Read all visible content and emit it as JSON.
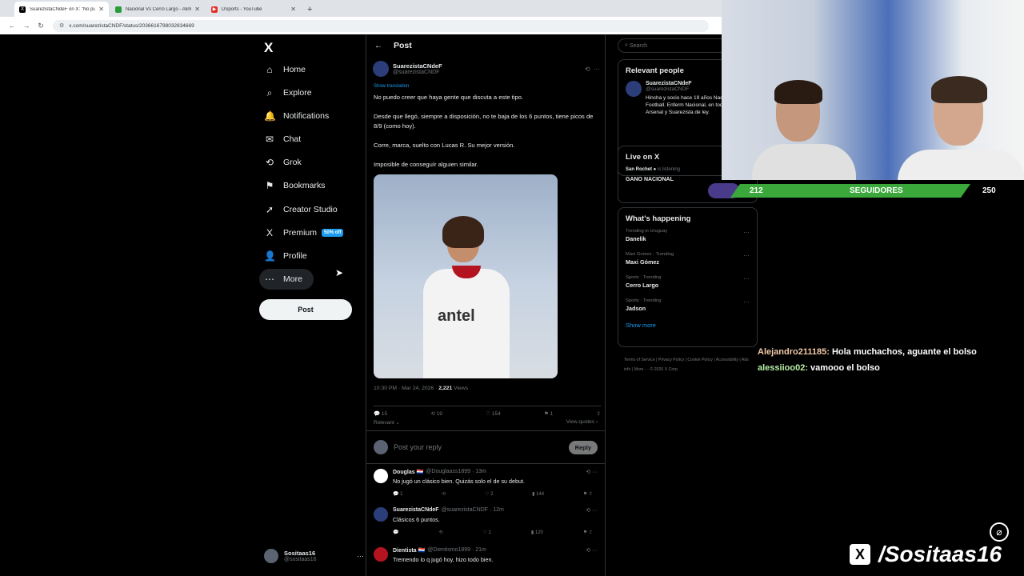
{
  "browser": {
    "tabs": [
      {
        "title": "SuarezistaCNdeF on X: \"No pue",
        "active": true,
        "favicon": "X"
      },
      {
        "title": "Nacional Vs Cerro Largo - Alim",
        "active": false,
        "favicon": "●"
      },
      {
        "title": "DSports - YouTube",
        "active": false,
        "favicon": "▶"
      }
    ],
    "url": "x.com/suarezistaCNDF/status/2036616798032834669"
  },
  "nav": {
    "logo": "X",
    "items": [
      {
        "label": "Home",
        "icon": "⌂"
      },
      {
        "label": "Explore",
        "icon": "⌕"
      },
      {
        "label": "Notifications",
        "icon": "🔔"
      },
      {
        "label": "Chat",
        "icon": "✉"
      },
      {
        "label": "Grok",
        "icon": "⟲"
      },
      {
        "label": "Bookmarks",
        "icon": "⚑"
      },
      {
        "label": "Creator Studio",
        "icon": "➚"
      },
      {
        "label": "Premium",
        "icon": "X"
      },
      {
        "label": "Profile",
        "icon": "👤"
      },
      {
        "label": "More",
        "icon": "⋯"
      }
    ],
    "premium_badge": "50% off",
    "post_button": "Post",
    "account": {
      "name": "Sositaas16",
      "handle": "@sositaas16"
    }
  },
  "post": {
    "header": "Post",
    "author_name": "SuarezistaCNdeF",
    "author_handle": "@suarezistaCNDF",
    "show_translation": "Show translation",
    "paragraphs": [
      "No puedo creer que haya gente que discuta a este tipo.",
      "Desde que llegó, siempre a disposición, no te baja de los 6 puntos, tiene picos de 8/9 (como hoy).",
      "Corre, marca, suelto con Lucas R. Su mejor versión.",
      "Imposible de conseguír alguien similar."
    ],
    "image_sponsor": "antel",
    "time": "10:30 PM · Mar 24, 2026 · ",
    "views": "2,221",
    "views_label": " Views",
    "stats": {
      "replies": "15",
      "reposts": "19",
      "likes": "154",
      "bookmarks": "1"
    },
    "relevant": "Relevant ⌄",
    "view_quotes": "View quotes ›",
    "reply_placeholder": "Post your reply",
    "reply_button": "Reply"
  },
  "replies": [
    {
      "name": "Douglas 🇵🇾",
      "handle": "@Douglaass1899 · 13m",
      "text": "No jugó un clásico bien. Quizás solo el de su debut.",
      "stats": [
        "1",
        "",
        "2",
        "144",
        "",
        ""
      ]
    },
    {
      "name": "SuarezistaCNdeF",
      "handle": "@suarezistaCNDF · 12m",
      "text": "Clásicos 6 puntos.",
      "stats": [
        "",
        "",
        "1",
        "120",
        "",
        ""
      ]
    },
    {
      "name": "Dientista 🇵🇾",
      "handle": "@Dientismo1899 · 21m",
      "text": "Tremendo lo q jugó hoy, hizo todo bien.",
      "stats": [
        "",
        "",
        "",
        "",
        "",
        ""
      ]
    }
  ],
  "sidebar": {
    "search_placeholder": "Search",
    "relevant_people": {
      "title": "Relevant people",
      "name": "SuarezistaCNdeF",
      "handle": "@suarezistaCNDF",
      "bio": "Hincha y socio hace 19 años Nacional de Football. Enferm Nacional, en todo. Arsenal y Suarezista de ley."
    },
    "live": {
      "title": "Live on X",
      "host": "San Rochet",
      "status": "is listening",
      "space_title": "GANO NACIONAL"
    },
    "happening": {
      "title": "What's happening",
      "trends": [
        {
          "context": "Trending in Uruguay",
          "name": "Danelik"
        },
        {
          "context": "Maxi Gomez · Trending",
          "name": "Maxi Gómez"
        },
        {
          "context": "Sports · Trending",
          "name": "Cerro Largo"
        },
        {
          "context": "Sports · Trending",
          "name": "Jadson"
        }
      ],
      "show_more": "Show more"
    },
    "footer": "Terms of Service | Privacy Policy | Cookie Policy | Accessibility | Ads info | More ··· © 2026 X Corp."
  },
  "stream": {
    "followers_left": "212",
    "followers_label": "SEGUIDORES",
    "followers_right": "250",
    "chat": [
      {
        "user": "Alejandro211185:",
        "message": " Hola muchachos, aguante el bolso"
      },
      {
        "user": "alessiioo02:",
        "message": " vamooo el bolso"
      }
    ],
    "handle": "/Sositaas16"
  }
}
